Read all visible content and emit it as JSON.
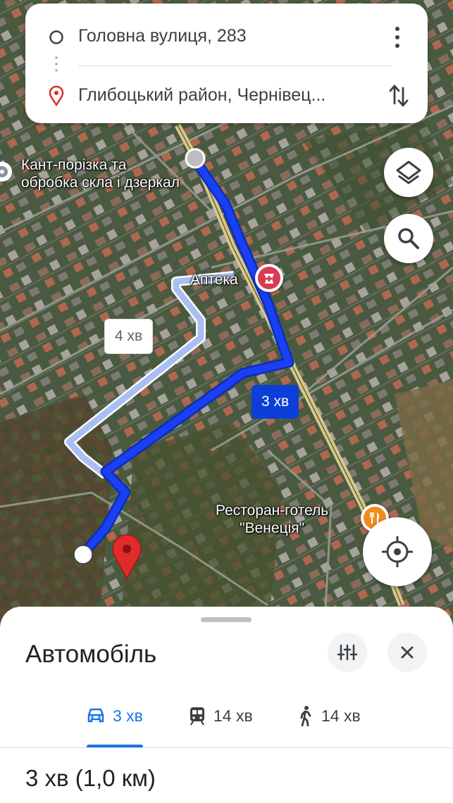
{
  "directions": {
    "origin": "Головна вулиця, 283",
    "destination": "Глибоцький район, Чернівец...",
    "origin_icon": "circle-outline-icon",
    "destination_icon": "location-pin-icon",
    "menu_icon": "more-vert-icon",
    "swap_icon": "swap-vert-icon"
  },
  "map": {
    "labels": {
      "glass_shop": "Кант-порізка та\nобробка скла і дзеркал",
      "pharmacy": "Аптека",
      "restaurant": "Ресторан-готель\n\"Венеція\""
    },
    "route_bubbles": {
      "alternative": "4 хв",
      "primary": "3 хв"
    },
    "colors": {
      "route_primary": "#1a3ff5",
      "route_alternative": "#a9bff3",
      "pharmacy_marker": "#d93b53",
      "restaurant_marker": "#f28a1d",
      "destination_pin": "#e02b2b",
      "road_main": "#d8c98b"
    },
    "buttons": {
      "layers_icon": "layers-icon",
      "search_icon": "search-icon",
      "my_location_icon": "my-location-icon"
    }
  },
  "sheet": {
    "title": "Автомобіль",
    "filter_icon": "tune-icon",
    "close_icon": "close-icon",
    "modes": [
      {
        "icon": "car-icon",
        "label": "3 хв",
        "active": true
      },
      {
        "icon": "train-icon",
        "label": "14 хв",
        "active": false
      },
      {
        "icon": "walk-icon",
        "label": "14 хв",
        "active": false
      }
    ],
    "summary": "3 хв (1,0 км)"
  }
}
